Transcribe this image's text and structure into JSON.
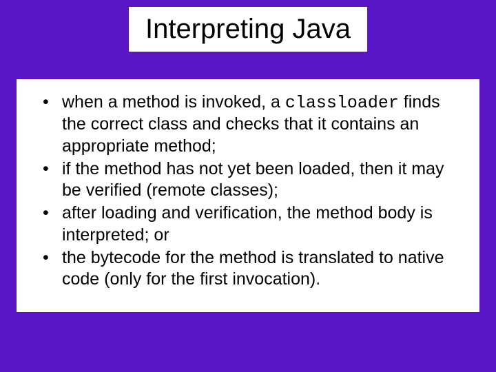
{
  "title": "Interpreting Java",
  "bullets": {
    "b1_pre": "when a method is invoked,  a ",
    "b1_code": "classloader",
    "b1_post": " finds the correct class and checks that it contains an appropriate method;",
    "b2": "if the method has not yet been loaded, then it may be verified (remote classes);",
    "b3": "after loading and verification, the method body is interpreted; or",
    "b4": "the bytecode for the method is translated to native code (only for the first invocation)."
  }
}
